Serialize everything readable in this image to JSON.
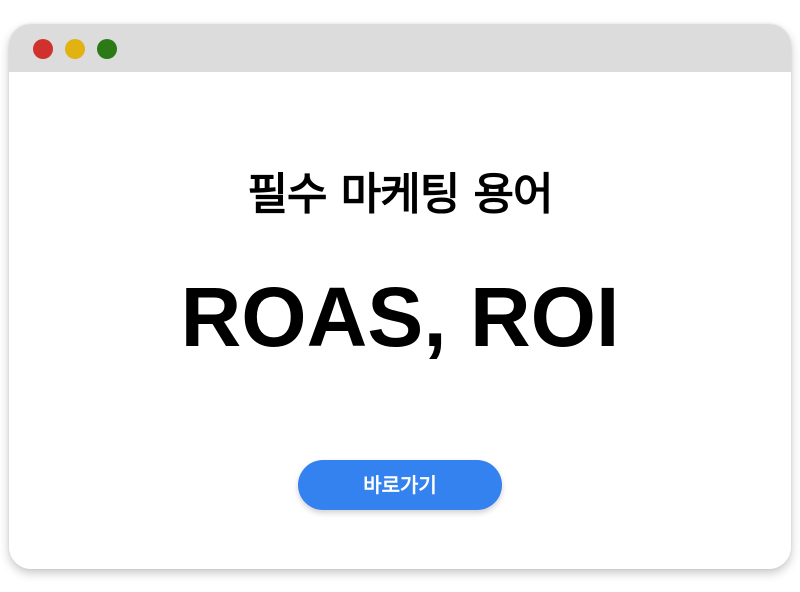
{
  "window": {
    "controls": {
      "close_color": "#d0312d",
      "minimize_color": "#e2b112",
      "maximize_color": "#2c7a16"
    },
    "titlebar_color": "#dcdcdc"
  },
  "main": {
    "subtitle": "필수 마케팅 용어",
    "headline": "ROAS, ROI",
    "cta_label": "바로가기",
    "cta_color": "#3481f0"
  }
}
